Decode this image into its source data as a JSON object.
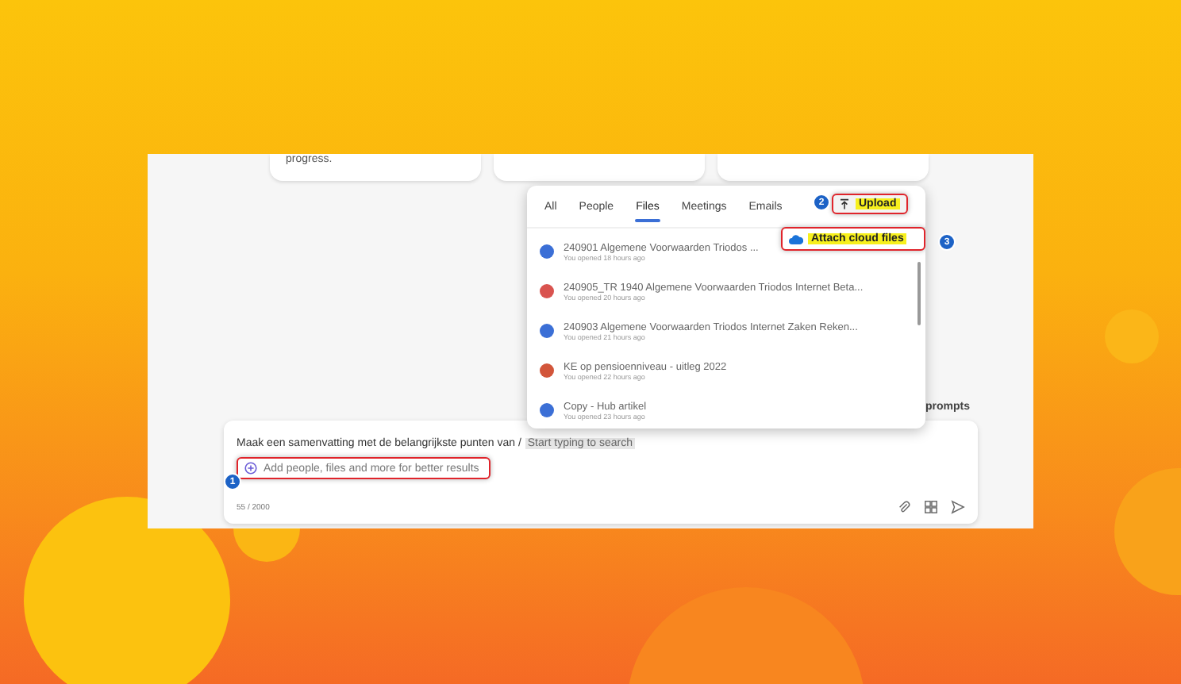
{
  "top_cards": [
    {
      "kind": "text",
      "text": "progress."
    },
    {
      "kind": "blank"
    },
    {
      "kind": "blank"
    }
  ],
  "picker": {
    "tabs": [
      {
        "label": "All",
        "selected": false
      },
      {
        "label": "People",
        "selected": false
      },
      {
        "label": "Files",
        "selected": true
      },
      {
        "label": "Meetings",
        "selected": false
      },
      {
        "label": "Emails",
        "selected": false
      }
    ],
    "upload_button": "Upload",
    "attach_item": "Attach cloud files",
    "files": [
      {
        "kind": "word",
        "name": "240901 Algemene Voorwaarden Triodos ...",
        "opened": "You opened 18 hours ago"
      },
      {
        "kind": "pdf",
        "name": "240905_TR 1940 Algemene Voorwaarden Triodos Internet Beta...",
        "opened": "You opened 20 hours ago"
      },
      {
        "kind": "word",
        "name": "240903 Algemene Voorwaarden Triodos Internet Zaken Reken...",
        "opened": "You opened 21 hours ago"
      },
      {
        "kind": "powerpoint",
        "name": "KE op pensioenniveau - uitleg 2022",
        "opened": "You opened 22 hours ago"
      },
      {
        "kind": "word",
        "name": "Copy - Hub artikel",
        "opened": "You opened 23 hours ago"
      }
    ]
  },
  "prompts_link": "prompts",
  "composer": {
    "value": "Maak een samenvatting met de belangrijkste punten van /",
    "search_hint": "Start typing to search",
    "add_hint": "Add people, files and more for better results",
    "counter": "55 / 2000"
  },
  "callouts": [
    "1",
    "2",
    "3"
  ]
}
